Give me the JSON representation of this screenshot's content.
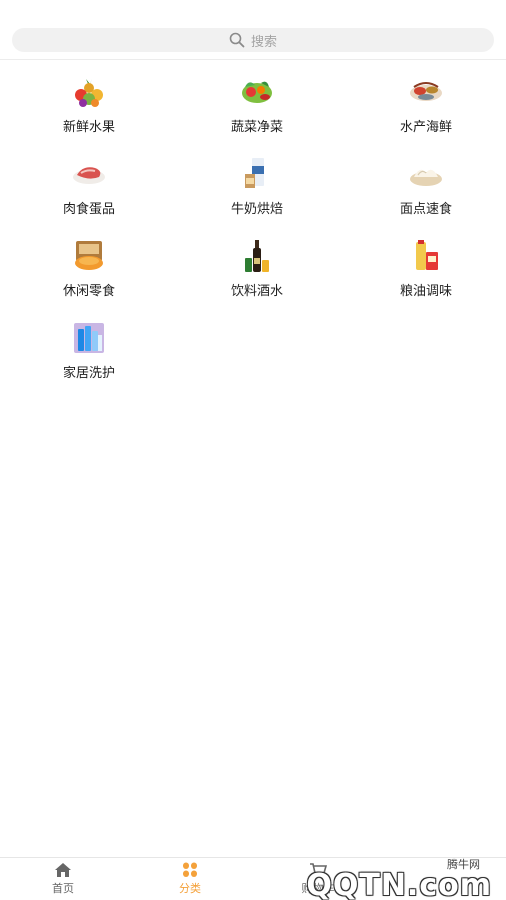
{
  "search": {
    "placeholder": "搜索"
  },
  "categories": [
    {
      "label": "新鲜水果",
      "icon": "fruit-basket-icon"
    },
    {
      "label": "蔬菜净菜",
      "icon": "vegetables-icon"
    },
    {
      "label": "水产海鲜",
      "icon": "seafood-icon"
    },
    {
      "label": "肉食蛋品",
      "icon": "meat-icon"
    },
    {
      "label": "牛奶烘焙",
      "icon": "milk-bakery-icon"
    },
    {
      "label": "面点速食",
      "icon": "dumplings-icon"
    },
    {
      "label": "休闲零食",
      "icon": "snacks-icon"
    },
    {
      "label": "饮料酒水",
      "icon": "drinks-icon"
    },
    {
      "label": "粮油调味",
      "icon": "grain-oil-icon"
    },
    {
      "label": "家居洗护",
      "icon": "household-care-icon"
    }
  ],
  "tabs": [
    {
      "label": "首页",
      "icon": "home-icon",
      "active": false
    },
    {
      "label": "分类",
      "icon": "category-icon",
      "active": true
    },
    {
      "label": "购物车",
      "icon": "cart-icon",
      "active": false
    }
  ],
  "watermark": {
    "small": "腾牛网",
    "big": "QQTN.com"
  },
  "colors": {
    "accent": "#f4a13a",
    "search_bg": "#f1f1f1",
    "divider": "#ececec"
  }
}
